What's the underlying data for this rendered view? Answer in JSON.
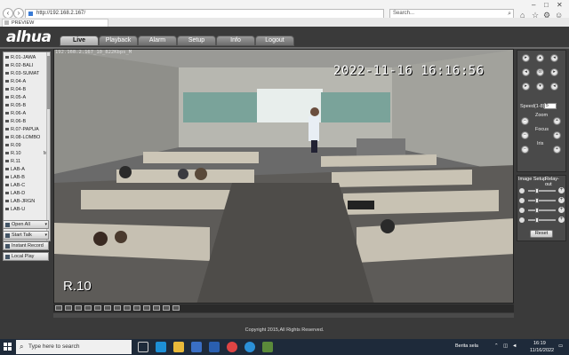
{
  "browser": {
    "url": "http://192.168.2.167/",
    "search_placeholder": "Search...",
    "tab_title": "PREVIEW"
  },
  "app": {
    "logo": "alhua",
    "logo_accent": "a",
    "menu": [
      "Live",
      "Playback",
      "Alarm",
      "Setup",
      "Info",
      "Logout"
    ],
    "active_menu": "Live",
    "footer": "Copyright 2015,All Rights Reserved."
  },
  "channels": [
    "R.01-JAWA",
    "R.02-BALI",
    "R.03-SUMAT",
    "R.04-A",
    "R.04-B",
    "R.05-A",
    "R.05-B",
    "R.06-A",
    "R.06-B",
    "R.07-PAPUA",
    "R.08-LOMBO",
    "R.09",
    "R.10",
    "R.11",
    "LAB-A",
    "LAB-B",
    "LAB-C",
    "LAB-D",
    "LAB-JRGN",
    "LAB-U"
  ],
  "selected_channel": "R.10",
  "selected_channel_flag": "M",
  "left_buttons": {
    "open_all": "Open All",
    "start_talk": "Start Talk",
    "instant_record": "Instant Record",
    "local_play": "Local Play"
  },
  "video": {
    "info": "192.168.2.167_10_822Kbps_M",
    "osd_time": "2022-11-16 16:16:56",
    "osd_name": "R.10"
  },
  "ptz": {
    "speed_label": "Speed(1-8)",
    "speed_value": "5",
    "zoom_label": "Zoom",
    "focus_label": "Focus",
    "iris_label": "Iris"
  },
  "image_setup": {
    "tab_image": "Image Setup",
    "tab_relay": "Relay-out",
    "reset_label": "Reset",
    "slider_levels": [
      0.3,
      0.3,
      0.3,
      0.3
    ]
  },
  "taskbar": {
    "search_placeholder": "Type here to search",
    "news": "Berita sela",
    "time": "16:19",
    "date": "11/16/2022"
  }
}
